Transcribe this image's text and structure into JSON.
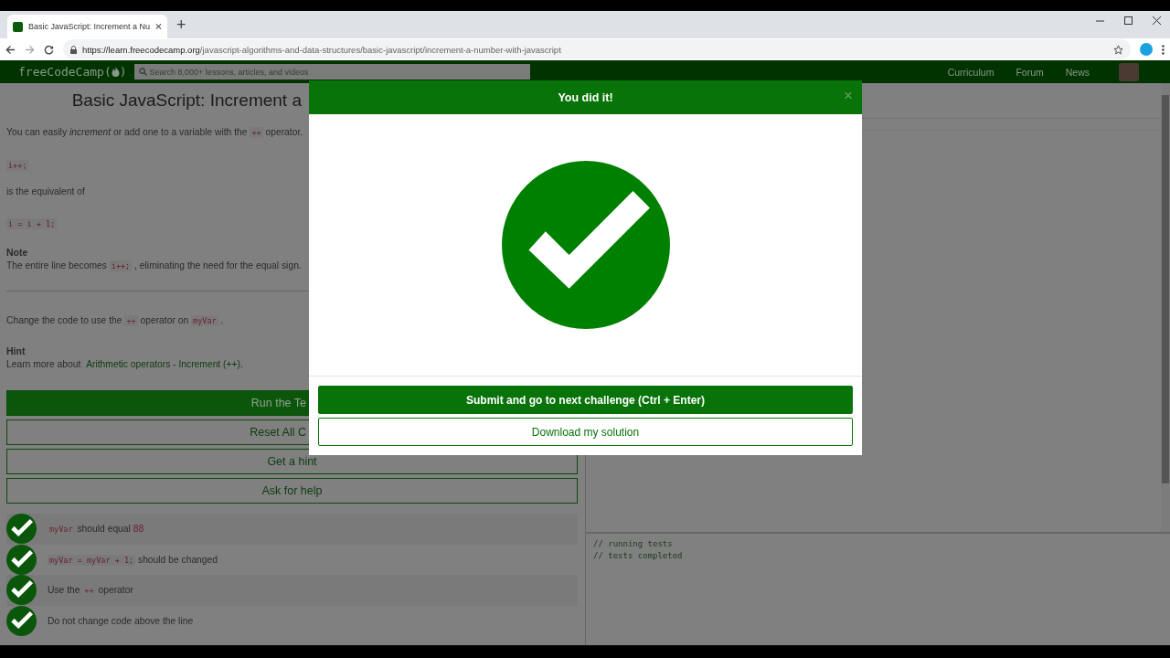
{
  "browser": {
    "tab_title": "Basic JavaScript: Increment a Nu",
    "new_tab": "+",
    "url_host": "https://learn.freecodecamp.org",
    "url_path": "/javascript-algorithms-and-data-structures/basic-javascript/increment-a-number-with-javascript"
  },
  "navbar": {
    "logo": "freeCodeCamp",
    "logo_open": "(",
    "logo_close": ")",
    "search": {
      "placeholder": "Search 8,000+ lessons, articles, and videos"
    },
    "links": [
      "Curriculum",
      "Forum",
      "News"
    ]
  },
  "lesson": {
    "title": "Basic JavaScript: Increment a",
    "blocks": [
      {
        "kind": "para",
        "parts": [
          {
            "kind": "plain",
            "text": "You can easily "
          },
          {
            "kind": "em",
            "text": "increment"
          },
          {
            "kind": "plain",
            "text": " or add one to a variable with the "
          },
          {
            "kind": "code",
            "text": "++"
          },
          {
            "kind": "plain",
            "text": " operator."
          }
        ]
      },
      {
        "kind": "codeblock",
        "parts": [
          {
            "kind": "code",
            "text": "i++;"
          }
        ]
      },
      {
        "kind": "para",
        "parts": [
          {
            "kind": "plain",
            "text": "is the equivalent of"
          }
        ]
      },
      {
        "kind": "codeblock",
        "parts": [
          {
            "kind": "code",
            "text": "i = i + 1;"
          }
        ]
      },
      {
        "kind": "heading",
        "parts": [
          {
            "kind": "plain",
            "text": "Note"
          }
        ]
      },
      {
        "kind": "para",
        "parts": [
          {
            "kind": "plain",
            "text": "The entire line becomes "
          },
          {
            "kind": "code",
            "text": "i++;"
          },
          {
            "kind": "plain",
            "text": " , eliminating the need for the equal sign."
          }
        ]
      },
      {
        "kind": "rule"
      },
      {
        "kind": "para",
        "parts": [
          {
            "kind": "plain",
            "text": "Change the code to use the "
          },
          {
            "kind": "code",
            "text": "++"
          },
          {
            "kind": "plain",
            "text": " operator on "
          },
          {
            "kind": "code",
            "text": "myVar"
          },
          {
            "kind": "plain",
            "text": " ."
          }
        ]
      },
      {
        "kind": "heading",
        "parts": [
          {
            "kind": "plain",
            "text": "Hint"
          }
        ]
      },
      {
        "kind": "para",
        "parts": [
          {
            "kind": "plain",
            "text": "Learn more about "
          },
          {
            "kind": "link",
            "text": "Arithmetic operators - Increment (++)"
          },
          {
            "kind": "plain",
            "text": "."
          }
        ]
      }
    ],
    "buttons": [
      {
        "label": "Run the Te",
        "primary": true
      },
      {
        "label": "Reset All C",
        "primary": false
      },
      {
        "label": "Get a hint",
        "primary": false
      },
      {
        "label": "Ask for help",
        "primary": false
      }
    ],
    "tests": [
      {
        "passed": true,
        "parts": [
          {
            "kind": "code",
            "text": "myVar"
          },
          {
            "kind": "plain",
            "text": " should equal "
          },
          {
            "kind": "num",
            "text": "88"
          }
        ]
      },
      {
        "passed": true,
        "parts": [
          {
            "kind": "code",
            "text": "myVar = myVar + 1;"
          },
          {
            "kind": "plain",
            "text": " should be changed"
          }
        ]
      },
      {
        "passed": true,
        "parts": [
          {
            "kind": "plain",
            "text": "Use the "
          },
          {
            "kind": "code",
            "text": "++"
          },
          {
            "kind": "plain",
            "text": " operator"
          }
        ]
      },
      {
        "passed": true,
        "parts": [
          {
            "kind": "plain",
            "text": "Do not change code above the line"
          }
        ]
      }
    ]
  },
  "console": {
    "lines": [
      "// running tests",
      "// tests completed"
    ]
  },
  "modal": {
    "title": "You did it!",
    "close": "×",
    "buttons": [
      {
        "label": "Submit and go to next challenge (Ctrl + Enter)",
        "primary": true
      },
      {
        "label": "Download my solution",
        "primary": false
      }
    ]
  }
}
